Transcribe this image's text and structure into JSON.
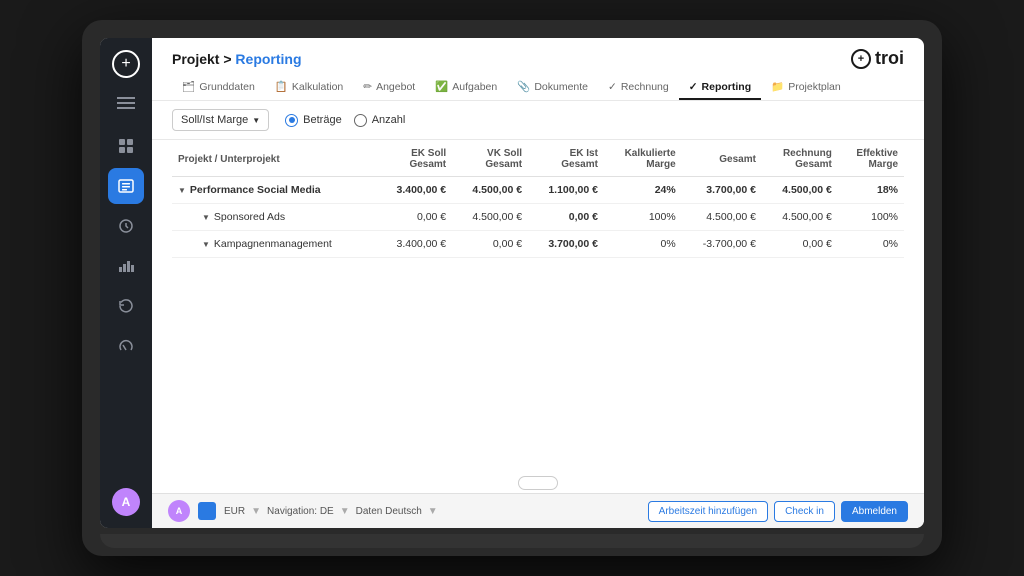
{
  "app": {
    "logo_circle": "+",
    "logo_name": "troi"
  },
  "breadcrumb": {
    "prefix": "Projekt > ",
    "active": "Reporting"
  },
  "tabs": [
    {
      "id": "grunddaten",
      "label": "Grunddaten",
      "icon": "🗂",
      "active": false
    },
    {
      "id": "kalkulation",
      "label": "Kalkulation",
      "icon": "📋",
      "active": false
    },
    {
      "id": "angebot",
      "label": "Angebot",
      "icon": "✏️",
      "active": false
    },
    {
      "id": "aufgaben",
      "label": "Aufgaben",
      "icon": "✅",
      "active": false
    },
    {
      "id": "dokumente",
      "label": "Dokumente",
      "icon": "📎",
      "active": false
    },
    {
      "id": "rechnung",
      "label": "Rechnung",
      "icon": "✅",
      "active": false
    },
    {
      "id": "reporting",
      "label": "Reporting",
      "icon": "✓",
      "active": true
    },
    {
      "id": "projektplan",
      "label": "Projektplan",
      "icon": "📁",
      "active": false
    }
  ],
  "toolbar": {
    "dropdown_label": "Soll/Ist Marge",
    "radio_options": [
      {
        "id": "betraege",
        "label": "Beträge",
        "selected": true
      },
      {
        "id": "anzahl",
        "label": "Anzahl",
        "selected": false
      }
    ]
  },
  "table": {
    "headers": [
      {
        "id": "project",
        "label": "Projekt / Unterprojekt"
      },
      {
        "id": "ek_soll",
        "label": "EK Soll Gesamt"
      },
      {
        "id": "vk_soll",
        "label": "VK Soll Gesamt"
      },
      {
        "id": "ek_ist",
        "label": "EK Ist Gesamt"
      },
      {
        "id": "kalk_marge",
        "label": "Kalkulierte Marge"
      },
      {
        "id": "gesamt",
        "label": "Gesamt"
      },
      {
        "id": "rechnung_gesamt",
        "label": "Rechnung Gesamt"
      },
      {
        "id": "eff_marge",
        "label": "Effektive Marge"
      }
    ],
    "rows": [
      {
        "type": "parent",
        "name": "Performance Social Media",
        "ek_soll": "3.400,00 €",
        "vk_soll": "4.500,00 €",
        "ek_ist": "1.100,00 €",
        "ek_ist_bold": true,
        "kalk_marge": "24%",
        "gesamt": "3.700,00 €",
        "gesamt_bold": true,
        "rechnung_gesamt": "4.500,00 €",
        "eff_marge": "18%"
      },
      {
        "type": "child",
        "name": "Sponsored Ads",
        "ek_soll": "0,00 €",
        "vk_soll": "4.500,00 €",
        "ek_ist": "0,00 €",
        "ek_ist_bold": true,
        "kalk_marge": "100%",
        "gesamt": "4.500,00 €",
        "gesamt_bold": false,
        "rechnung_gesamt": "4.500,00 €",
        "eff_marge": "100%"
      },
      {
        "type": "child",
        "name": "Kampagnenmanagement",
        "ek_soll": "3.400,00 €",
        "vk_soll": "0,00 €",
        "ek_ist": "3.700,00 €",
        "ek_ist_bold": true,
        "kalk_marge": "0%",
        "gesamt": "-3.700,00 €",
        "gesamt_bold": false,
        "rechnung_gesamt": "0,00 €",
        "eff_marge": "0%"
      }
    ]
  },
  "footer": {
    "currency": "EUR",
    "nav_label": "Navigation: DE",
    "data_label": "Daten Deutsch",
    "btn_arbeitszeit": "Arbeitszeit hinzufügen",
    "btn_checkin": "Check in",
    "btn_abmelden": "Abmelden"
  },
  "sidebar": {
    "nav_items": [
      {
        "id": "grid",
        "icon": "⊞",
        "active": false
      },
      {
        "id": "projects",
        "icon": "◫",
        "active": true
      },
      {
        "id": "clock",
        "icon": "⏱",
        "active": false
      },
      {
        "id": "chart",
        "icon": "📊",
        "active": false
      },
      {
        "id": "history",
        "icon": "↺",
        "active": false
      },
      {
        "id": "gauge",
        "icon": "⊥",
        "active": false
      }
    ]
  }
}
